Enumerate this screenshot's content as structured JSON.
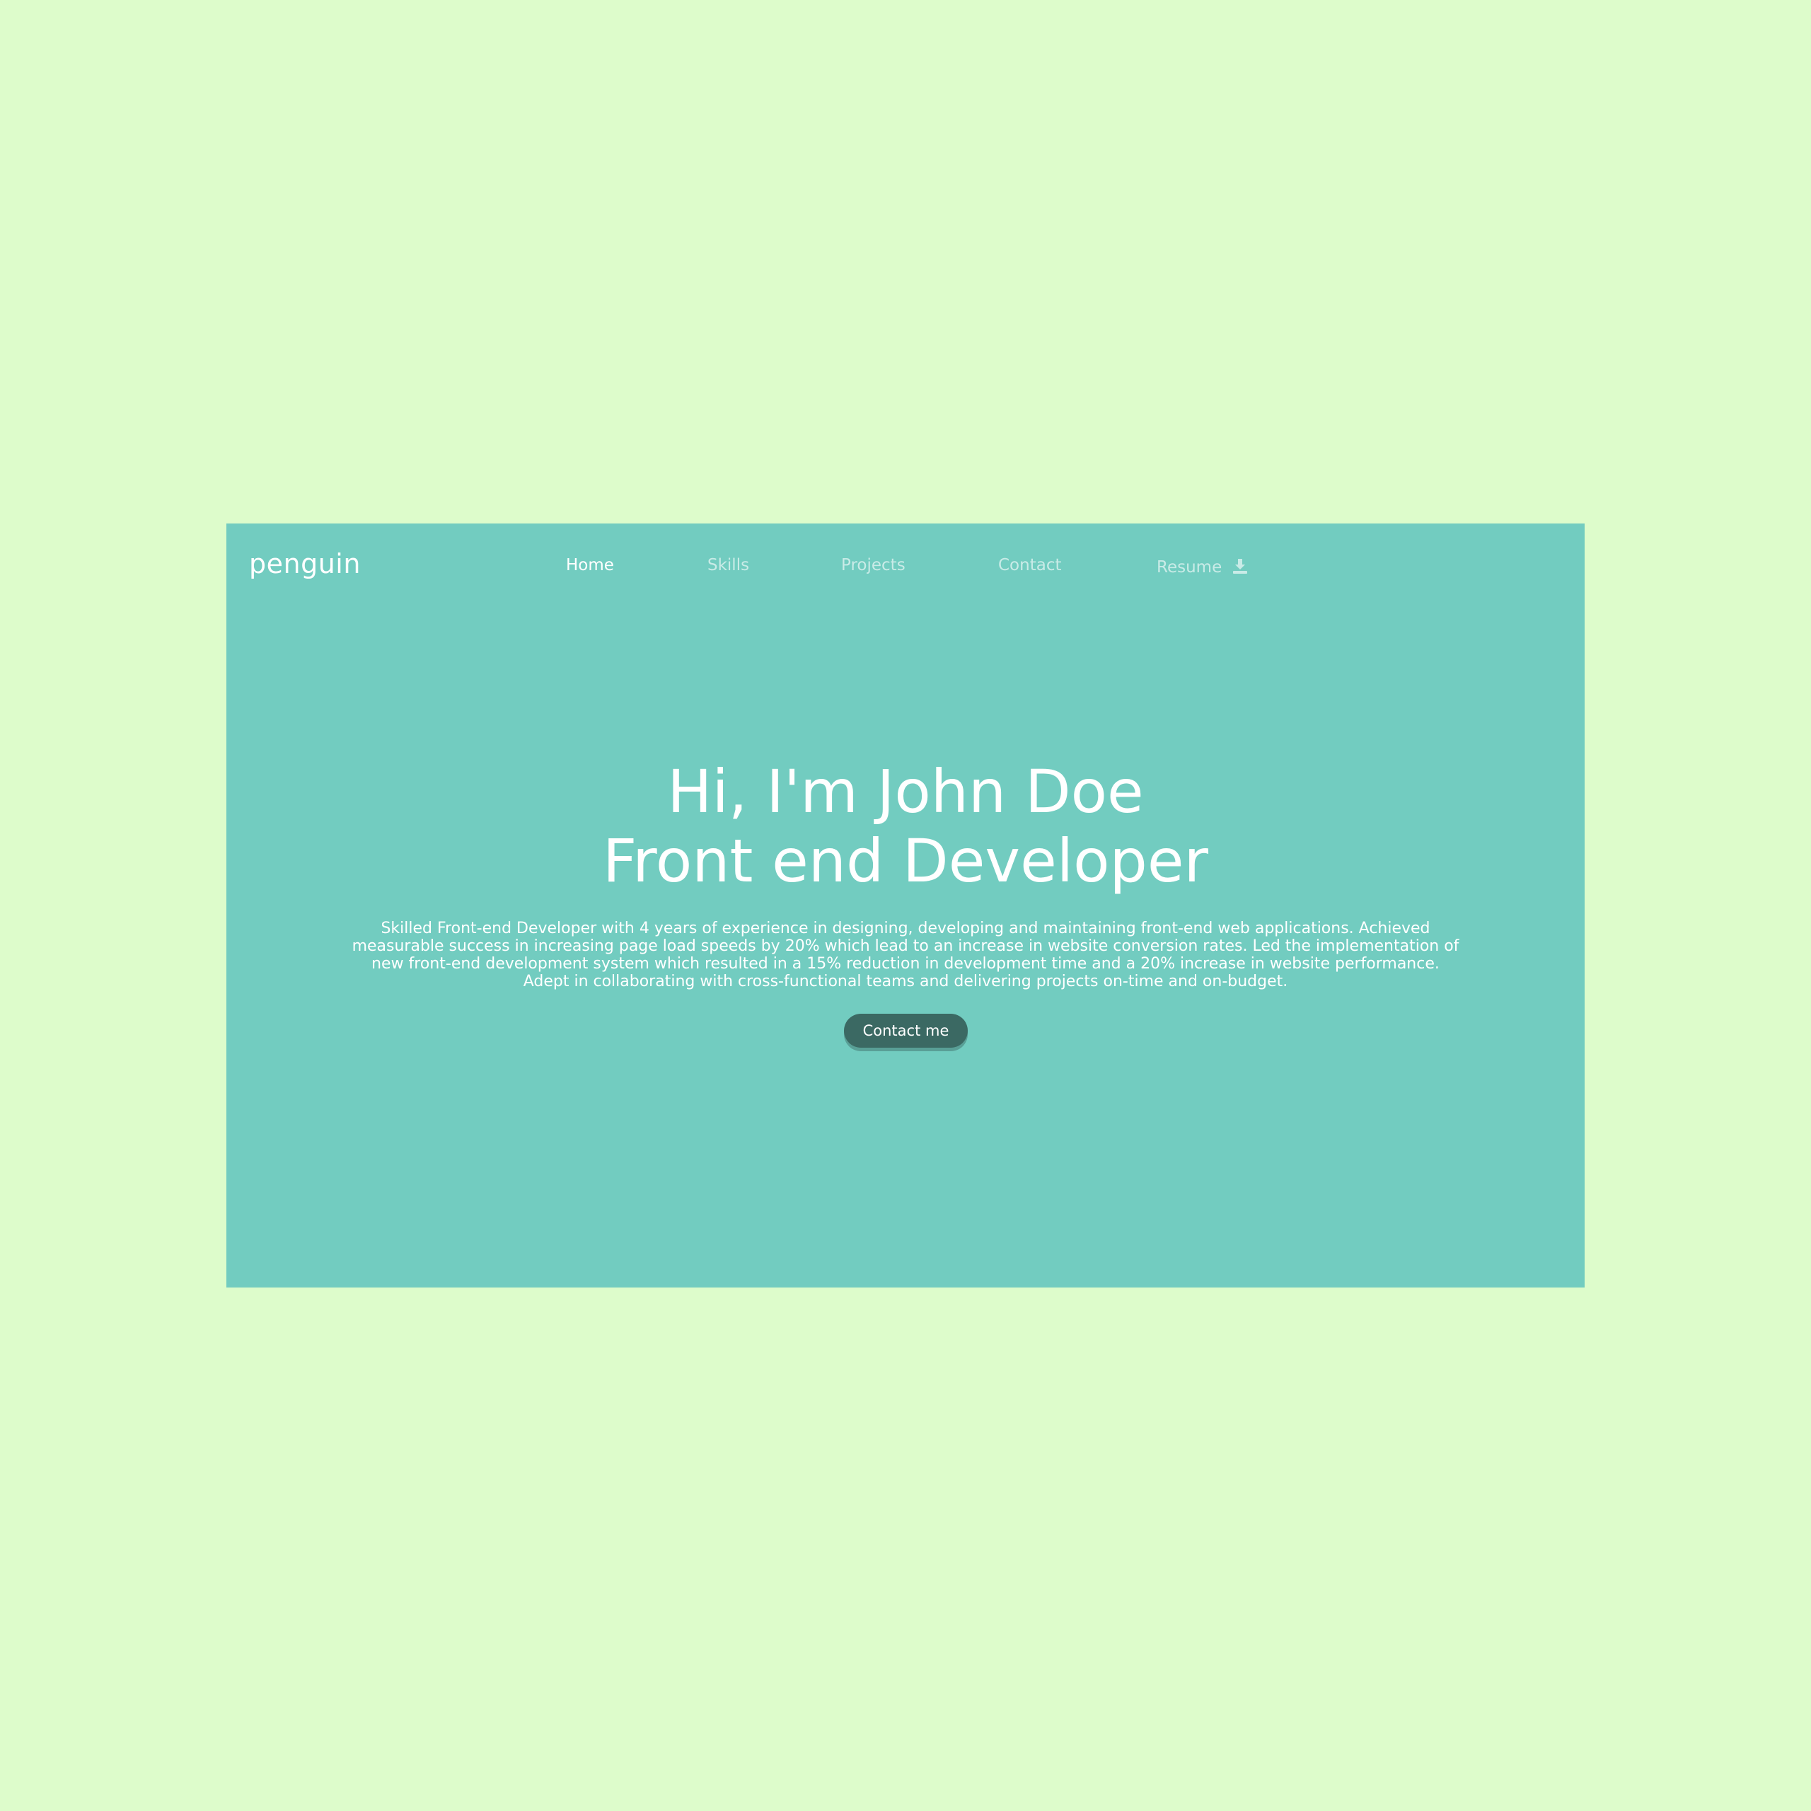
{
  "brand": {
    "logo_text": "penguin"
  },
  "nav": {
    "items": [
      {
        "label": "Home",
        "active": true
      },
      {
        "label": "Skills",
        "active": false
      },
      {
        "label": "Projects",
        "active": false
      },
      {
        "label": "Contact",
        "active": false
      },
      {
        "label": "Resume",
        "active": false,
        "icon": "download-icon"
      }
    ]
  },
  "hero": {
    "title_line1": "Hi, I'm John Doe",
    "title_line2": "Front end Developer",
    "description": "Skilled Front-end Developer with 4 years of experience in designing, developing and maintaining front-end web applications. Achieved measurable success in increasing page load speeds by 20% which lead to an increase in website conversion rates. Led the implementation of new front-end development system which resulted in a 15% reduction in development time and a 20% increase in website performance. Adept in collaborating with cross-functional teams and delivering projects on-time and on-budget.",
    "cta_label": "Contact me"
  },
  "colors": {
    "page_background": "#ddfccb",
    "hero_background": "#72ccc0",
    "button_background": "#3b6963",
    "text": "#ffffff"
  }
}
